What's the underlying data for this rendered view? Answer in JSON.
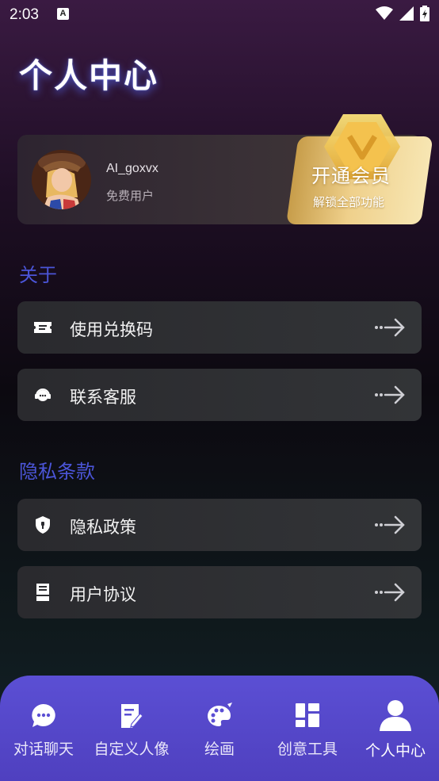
{
  "status_bar": {
    "time": "2:03",
    "notification_letter": "A"
  },
  "header": {
    "title": "个人中心"
  },
  "profile": {
    "username": "AI_goxvx",
    "tier": "免费用户"
  },
  "vip": {
    "title": "开通会员",
    "subtitle": "解锁全部功能",
    "colors": {
      "gold_light": "#f7e6b3",
      "gold_dark": "#c79d4a"
    }
  },
  "sections": {
    "about": {
      "title": "关于",
      "items": [
        {
          "label": "使用兑换码",
          "icon": "ticket-icon"
        },
        {
          "label": "联系客服",
          "icon": "headset-icon"
        }
      ]
    },
    "privacy": {
      "title": "隐私条款",
      "items": [
        {
          "label": "隐私政策",
          "icon": "shield-icon"
        },
        {
          "label": "用户协议",
          "icon": "document-icon"
        }
      ]
    }
  },
  "tab_bar": {
    "tabs": [
      {
        "label": "对话聊天",
        "icon": "chat-icon"
      },
      {
        "label": "自定义人像",
        "icon": "edit-icon"
      },
      {
        "label": "绘画",
        "icon": "palette-icon"
      },
      {
        "label": "创意工具",
        "icon": "grid-icon"
      },
      {
        "label": "个人中心",
        "icon": "person-icon"
      }
    ],
    "active_index": 4
  },
  "colors": {
    "accent": "#4b55d8",
    "tab_bar": "#5b4fd4"
  }
}
